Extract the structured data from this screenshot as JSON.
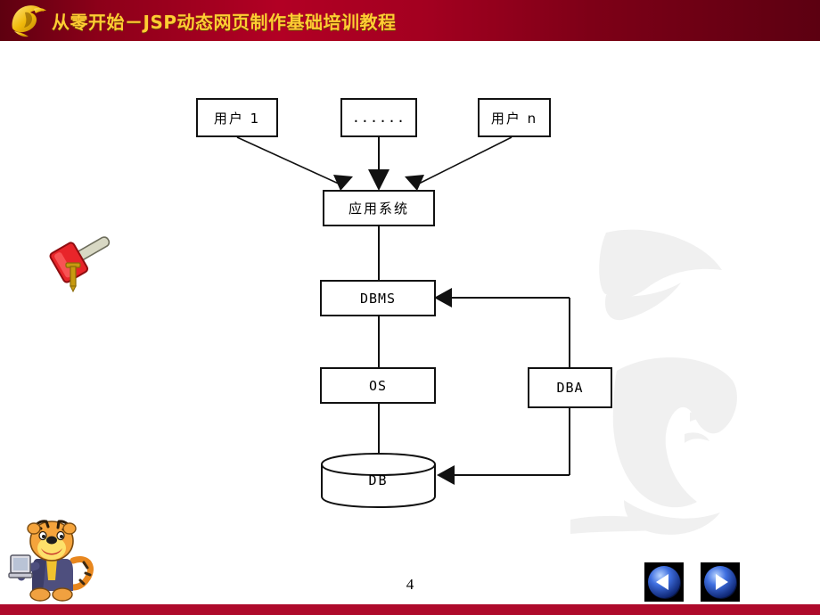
{
  "header": {
    "title": "从零开始－JSP动态网页制作基础培训教程",
    "logo_icon": "spartan-helmet-icon",
    "bg_start": "#5e0010",
    "bg_mid": "#b20024",
    "bg_end": "#5c0011",
    "title_color": "#ffcc33"
  },
  "diagram": {
    "type": "flowchart",
    "nodes": [
      {
        "id": "user1",
        "label": "用户 1",
        "shape": "rect"
      },
      {
        "id": "ellipsis",
        "label": "......",
        "shape": "rect"
      },
      {
        "id": "usern",
        "label": "用户 n",
        "shape": "rect"
      },
      {
        "id": "app",
        "label": "应用系统",
        "shape": "rect"
      },
      {
        "id": "dbms",
        "label": "DBMS",
        "shape": "rect"
      },
      {
        "id": "os",
        "label": "OS",
        "shape": "rect"
      },
      {
        "id": "dba",
        "label": "DBA",
        "shape": "rect"
      },
      {
        "id": "db",
        "label": "DB",
        "shape": "cylinder"
      }
    ],
    "edges": [
      {
        "from": "user1",
        "to": "app",
        "arrow": true
      },
      {
        "from": "ellipsis",
        "to": "app",
        "arrow": true
      },
      {
        "from": "usern",
        "to": "app",
        "arrow": true
      },
      {
        "from": "app",
        "to": "dbms",
        "arrow": false
      },
      {
        "from": "dbms",
        "to": "os",
        "arrow": false
      },
      {
        "from": "os",
        "to": "db",
        "arrow": false
      },
      {
        "from": "dba",
        "to": "dbms",
        "arrow": true
      },
      {
        "from": "dba",
        "to": "db",
        "arrow": true
      }
    ],
    "line_color": "#111111"
  },
  "decoration": {
    "mallet_icon": "red-mallet-icon",
    "mascot_icon": "tiger-mascot-icon",
    "watermark_icon": "portrait-watermark"
  },
  "footer": {
    "page_number": "4",
    "prev_icon": "left-triangle-icon",
    "next_icon": "right-triangle-icon",
    "strip_color": "#ae0a2b"
  }
}
